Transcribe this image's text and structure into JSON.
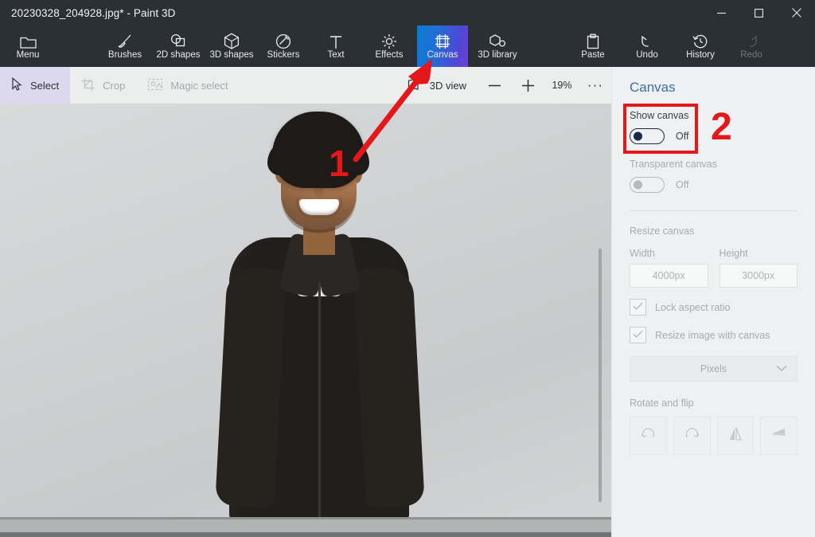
{
  "window": {
    "title": "20230328_204928.jpg* - Paint 3D",
    "minimize_label": "Minimize",
    "maximize_label": "Maximize",
    "close_label": "Close"
  },
  "ribbon": {
    "items": [
      {
        "label": "Menu",
        "icon": "menu-folder-icon",
        "state": "normal"
      },
      {
        "label": "Brushes",
        "icon": "brush-icon",
        "state": "normal"
      },
      {
        "label": "2D shapes",
        "icon": "2d-shapes-icon",
        "state": "normal"
      },
      {
        "label": "3D shapes",
        "icon": "3d-cube-icon",
        "state": "normal"
      },
      {
        "label": "Stickers",
        "icon": "sticker-icon",
        "state": "normal"
      },
      {
        "label": "Text",
        "icon": "text-icon",
        "state": "normal"
      },
      {
        "label": "Effects",
        "icon": "effects-sun-icon",
        "state": "normal"
      },
      {
        "label": "Canvas",
        "icon": "canvas-frame-icon",
        "state": "active"
      },
      {
        "label": "3D library",
        "icon": "3d-library-icon",
        "state": "normal"
      },
      {
        "label": "Paste",
        "icon": "clipboard-paste-icon",
        "state": "normal"
      },
      {
        "label": "Undo",
        "icon": "undo-arrow-icon",
        "state": "normal"
      },
      {
        "label": "History",
        "icon": "history-clock-icon",
        "state": "normal"
      },
      {
        "label": "Redo",
        "icon": "redo-arrow-icon",
        "state": "disabled"
      }
    ],
    "collapse_icon": "chevron-up-icon"
  },
  "subbar": {
    "select_label": "Select",
    "crop_label": "Crop",
    "magic_select_label": "Magic select",
    "view_3d_label": "3D view",
    "zoom_out_label": "−",
    "zoom_in_label": "+",
    "zoom_value": "19%",
    "more_label": "···"
  },
  "panel": {
    "title": "Canvas",
    "show_canvas": {
      "label": "Show canvas",
      "state": "Off"
    },
    "transparent_canvas": {
      "label": "Transparent canvas",
      "state": "Off"
    },
    "resize_canvas_label": "Resize canvas",
    "width": {
      "label": "Width",
      "value": "4000px"
    },
    "height": {
      "label": "Height",
      "value": "3000px"
    },
    "lock_aspect_ratio": "Lock aspect ratio",
    "resize_image_with_canvas": "Resize image with canvas",
    "units_value": "Pixels",
    "rotate_and_flip_label": "Rotate and flip",
    "rotate_flip_buttons": [
      "rotate-left-icon",
      "rotate-right-icon",
      "flip-horizontal-icon",
      "flip-vertical-icon"
    ]
  },
  "annotations": {
    "step_one": "1",
    "step_two": "2",
    "accent_color": "#e4181b"
  },
  "colors": {
    "titlebar_bg": "#2b3036",
    "ribbon_bg": "#2b3036",
    "active_tab_gradient_start": "#0a7bd0",
    "active_tab_gradient_end": "#6f3fd6",
    "subbar_bg": "#eceded",
    "select_active_bg": "#dcd9ef",
    "workspace_bg": "#b1b4b3",
    "panel_bg": "#eef0f1",
    "panel_title": "#3d6fa8"
  }
}
